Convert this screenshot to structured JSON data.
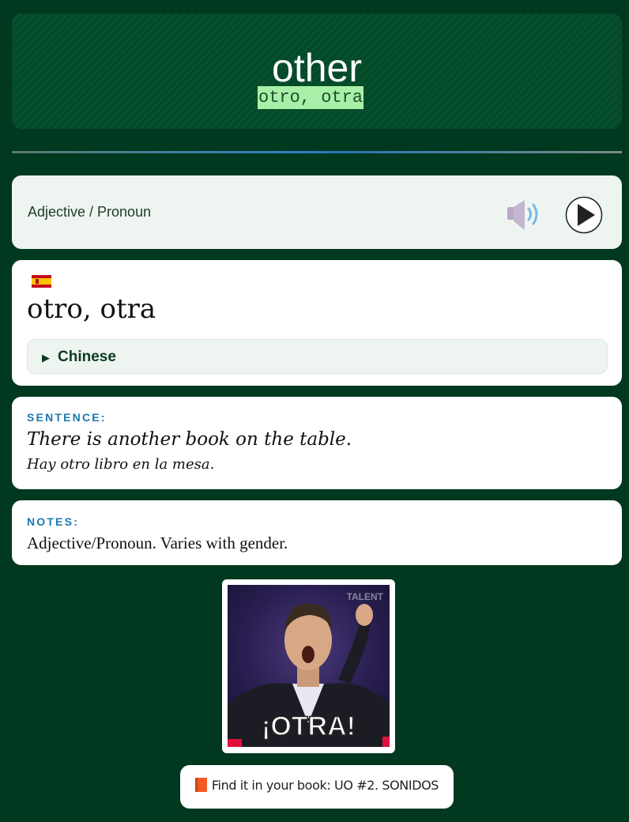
{
  "header": {
    "word": "other",
    "translation": "otro, otra"
  },
  "pos_card": {
    "part_of_speech": "Adjective / Pronoun"
  },
  "word_card": {
    "flag": "spain-flag",
    "target_word": "otro, otra",
    "details_label": "Chinese"
  },
  "sentence_card": {
    "label": "SENTENCE:",
    "english": "There is another book on the table.",
    "spanish": "Hay otro libro en la mesa."
  },
  "notes_card": {
    "label": "NOTES:",
    "text": "Adjective/Pronoun. Varies with gender."
  },
  "gif": {
    "watermark": "TALENT",
    "caption": "¡OTRA!"
  },
  "book_button": {
    "label": "Find it in your book: UO #2. SONIDOS"
  },
  "colors": {
    "background": "#003820",
    "header": "#024a28",
    "highlight": "#a8f0a8",
    "label_blue": "#1a78b0"
  }
}
